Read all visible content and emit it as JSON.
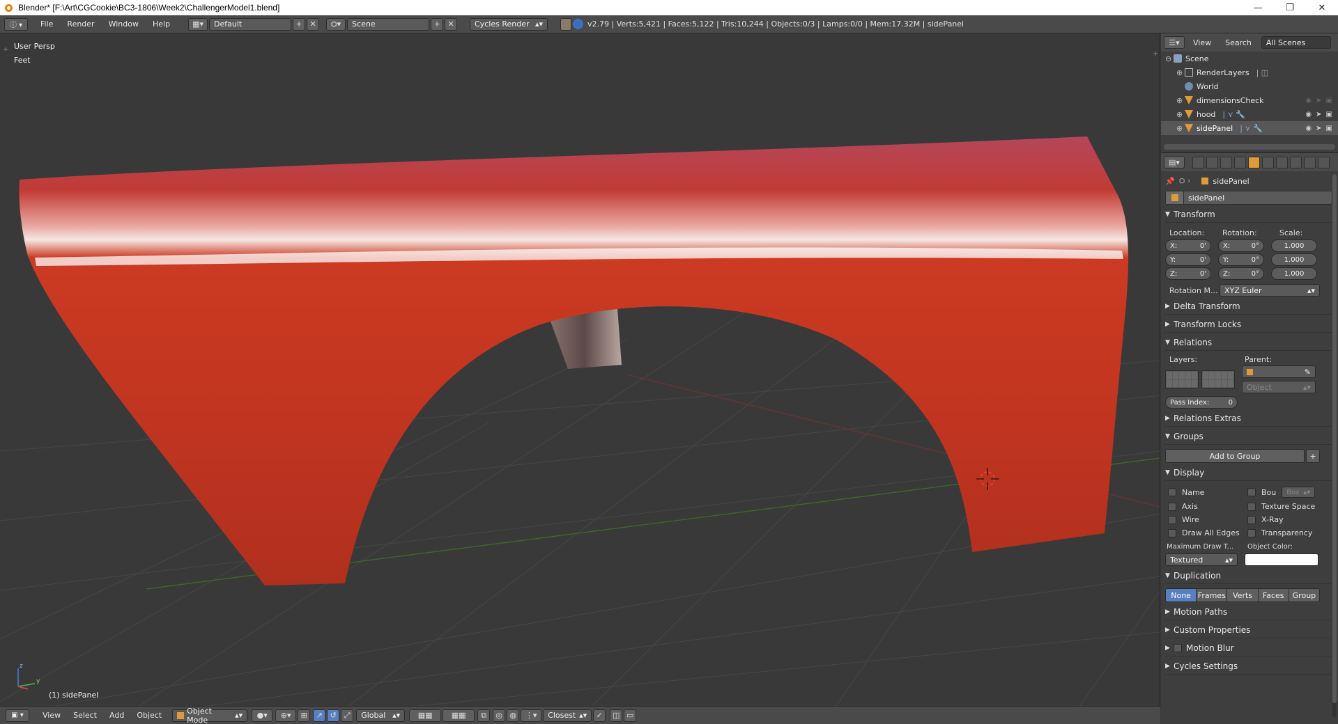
{
  "window": {
    "title": "Blender* [F:\\Art\\CGCookie\\BC3-1806\\Week2\\ChallengerModel1.blend]",
    "minimize": "—",
    "maximize": "❐",
    "close": "✕"
  },
  "topbar": {
    "menus": [
      "File",
      "Render",
      "Window",
      "Help"
    ],
    "layout": "Default",
    "scene": "Scene",
    "engine": "Cycles Render",
    "stats": "v2.79 | Verts:5,421 | Faces:5,122 | Tris:10,244 | Objects:0/3 | Lamps:0/0 | Mem:17.32M | sidePanel"
  },
  "viewport": {
    "view_label": "User Persp",
    "units_label": "Feet",
    "object_label": "(1) sidePanel",
    "axis_z": "z",
    "axis_y": "y",
    "mesh_color": "#c1331e"
  },
  "bottombar": {
    "menus": [
      "View",
      "Select",
      "Add",
      "Object"
    ],
    "mode": "Object Mode",
    "orientation": "Global",
    "snap": "Closest"
  },
  "outliner": {
    "tabs": [
      "View",
      "Search",
      "All Scenes"
    ],
    "items": [
      {
        "label": "Scene",
        "icon": "scene-icon"
      },
      {
        "label": "RenderLayers",
        "icon": "render-layers-icon"
      },
      {
        "label": "World",
        "icon": "world-icon"
      },
      {
        "label": "dimensionsCheck",
        "icon": "mesh-icon"
      },
      {
        "label": "hood",
        "icon": "mesh-icon"
      },
      {
        "label": "sidePanel",
        "icon": "mesh-icon"
      }
    ]
  },
  "properties": {
    "breadcrumb": "sidePanel",
    "object_name": "sidePanel",
    "transform": {
      "title": "Transform",
      "location_label": "Location:",
      "rotation_label": "Rotation:",
      "scale_label": "Scale:",
      "location": [
        {
          "axis": "X:",
          "value": "0'"
        },
        {
          "axis": "Y:",
          "value": "0'"
        },
        {
          "axis": "Z:",
          "value": "0'"
        }
      ],
      "rotation": [
        {
          "axis": "X:",
          "value": "0°"
        },
        {
          "axis": "Y:",
          "value": "0°"
        },
        {
          "axis": "Z:",
          "value": "0°"
        }
      ],
      "scale": [
        "1.000",
        "1.000",
        "1.000"
      ],
      "rotation_mode_label": "Rotation M...",
      "rotation_mode": "XYZ Euler"
    },
    "sections": {
      "delta_transform": "Delta Transform",
      "transform_locks": "Transform Locks",
      "relations": "Relations",
      "relations_extras": "Relations Extras",
      "groups": "Groups",
      "display": "Display",
      "duplication": "Duplication",
      "motion_paths": "Motion Paths",
      "custom_properties": "Custom Properties",
      "motion_blur": "Motion Blur",
      "cycles_settings": "Cycles Settings"
    },
    "relations": {
      "layers_label": "Layers:",
      "parent_label": "Parent:",
      "parent_type": "Object",
      "pass_index_label": "Pass Index:",
      "pass_index": "0"
    },
    "groups": {
      "add_to_group": "Add to Group"
    },
    "display": {
      "name": "Name",
      "bounds": "Bou",
      "bounds_type": "Box",
      "axis": "Axis",
      "texture_space": "Texture Space",
      "wire": "Wire",
      "xray": "X-Ray",
      "draw_all_edges": "Draw All Edges",
      "transparency": "Transparency",
      "max_draw_label": "Maximum Draw T...",
      "object_color_label": "Object Color:",
      "max_draw_type": "Textured",
      "object_color": "#ffffff"
    },
    "duplication": {
      "options": [
        "None",
        "Frames",
        "Verts",
        "Faces",
        "Group"
      ],
      "selected": "None"
    }
  }
}
